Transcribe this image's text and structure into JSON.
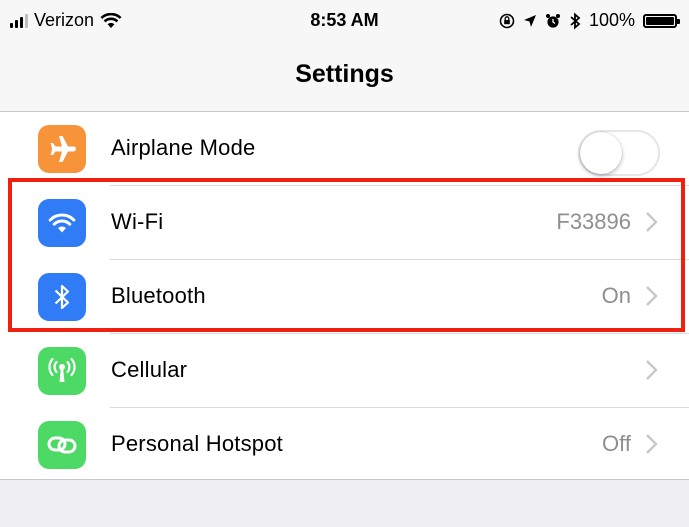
{
  "status_bar": {
    "carrier": "Verizon",
    "time": "8:53 AM",
    "battery": "100%"
  },
  "nav": {
    "title": "Settings"
  },
  "rows": [
    {
      "label": "Airplane Mode",
      "icon": "airplane-icon",
      "icon_bg": "#f7943a",
      "toggle_on": false
    },
    {
      "label": "Wi-Fi",
      "detail": "F33896",
      "icon": "wifi-icon",
      "icon_bg": "#2f7cf6"
    },
    {
      "label": "Bluetooth",
      "detail": "On",
      "icon": "bluetooth-icon",
      "icon_bg": "#2f7cf6"
    },
    {
      "label": "Cellular",
      "detail": "",
      "icon": "cellular-icon",
      "icon_bg": "#4cd964"
    },
    {
      "label": "Personal Hotspot",
      "detail": "Off",
      "icon": "hotspot-icon",
      "icon_bg": "#4cd964"
    }
  ],
  "highlight_color": "#f02010"
}
